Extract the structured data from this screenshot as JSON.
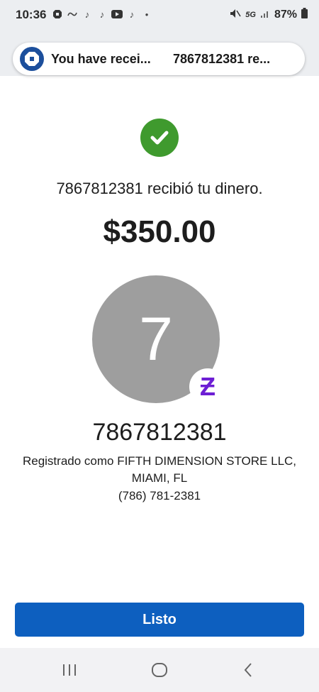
{
  "status_bar": {
    "time": "10:36",
    "network": "5G",
    "battery": "87%"
  },
  "notification": {
    "title": "You have recei...",
    "detail": "7867812381 re..."
  },
  "confirmation": {
    "message": "7867812381 recibió tu dinero.",
    "amount": "$350.00"
  },
  "recipient": {
    "avatar_letter": "7",
    "badge": "Ƶ",
    "name": "7867812381",
    "registered_line1": "Registrado como FIFTH DIMENSION STORE LLC,",
    "registered_line2": "MIAMI, FL",
    "phone": "(786) 781-2381"
  },
  "actions": {
    "done_label": "Listo"
  },
  "colors": {
    "primary_button": "#0d5fbf",
    "success": "#3f9a2e",
    "zelle_purple": "#6d1ed4",
    "avatar": "#9e9e9e"
  }
}
